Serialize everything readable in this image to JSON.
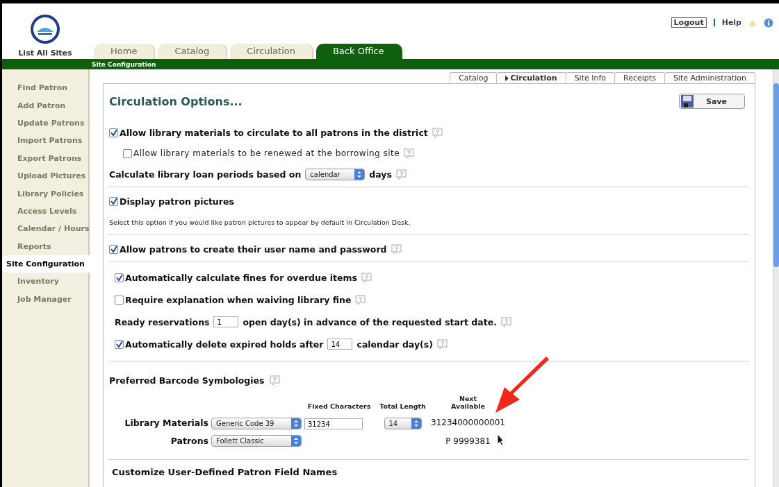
{
  "header": {
    "site_link": "List All Sites",
    "logout": "Logout",
    "help": "Help"
  },
  "main_tabs": [
    {
      "label": "Home",
      "selected": false
    },
    {
      "label": "Catalog",
      "selected": false
    },
    {
      "label": "Circulation",
      "selected": false
    },
    {
      "label": "Back Office",
      "selected": true
    }
  ],
  "subnav": "Site Configuration",
  "sidebar": {
    "items": [
      {
        "label": "Find Patron",
        "selected": false
      },
      {
        "label": "Add Patron",
        "selected": false
      },
      {
        "label": "Update Patrons",
        "selected": false
      },
      {
        "label": "Import Patrons",
        "selected": false
      },
      {
        "label": "Export Patrons",
        "selected": false
      },
      {
        "label": "Upload Pictures",
        "selected": false
      },
      {
        "label": "Library Policies",
        "selected": false
      },
      {
        "label": "Access Levels",
        "selected": false
      },
      {
        "label": "Calendar / Hours",
        "selected": false
      },
      {
        "label": "Reports",
        "selected": false
      },
      {
        "label": "Site Configuration",
        "selected": true
      },
      {
        "label": "Inventory",
        "selected": false
      },
      {
        "label": "Job Manager",
        "selected": false
      }
    ]
  },
  "sub_tabs": [
    {
      "label": "Catalog",
      "selected": false
    },
    {
      "label": "Circulation",
      "selected": true
    },
    {
      "label": "Site Info",
      "selected": false
    },
    {
      "label": "Receipts",
      "selected": false
    },
    {
      "label": "Site Administration",
      "selected": false
    }
  ],
  "panel": {
    "title": "Circulation Options...",
    "save_button": "Save",
    "sections": [
      {
        "inset": false,
        "rows": [
          {
            "kind": "check",
            "checked": true,
            "help": true,
            "parts": [
              {
                "kind": "text",
                "text": "Allow library materials to circulate to all patrons in the district"
              }
            ]
          },
          {
            "kind": "minor",
            "checked": false,
            "help": true,
            "parts": [
              {
                "kind": "text",
                "text": "Allow library materials to be renewed at the borrowing site"
              }
            ]
          },
          {
            "kind": "line",
            "help": true,
            "parts": [
              {
                "kind": "text",
                "text": "Calculate library loan periods based on"
              },
              {
                "kind": "select",
                "value": "calendar"
              },
              {
                "kind": "text",
                "text": "days"
              }
            ]
          }
        ]
      },
      {
        "inset": false,
        "rows": [
          {
            "kind": "check",
            "checked": true,
            "help": false,
            "parts": [
              {
                "kind": "text",
                "text": "Display patron pictures"
              }
            ]
          },
          {
            "kind": "note",
            "help": false,
            "parts": [
              {
                "kind": "text",
                "text": "Select this option if you would like patron pictures to appear by default in Circulation Desk."
              }
            ]
          }
        ]
      },
      {
        "inset": false,
        "rows": [
          {
            "kind": "check",
            "checked": true,
            "help": true,
            "parts": [
              {
                "kind": "text",
                "text": "Allow patrons to create their user name and password"
              }
            ]
          }
        ]
      },
      {
        "inset": true,
        "rows": [
          {
            "kind": "check",
            "checked": true,
            "help": true,
            "parts": [
              {
                "kind": "text",
                "text": "Automatically calculate fines for overdue items"
              }
            ]
          },
          {
            "kind": "check",
            "checked": false,
            "help": true,
            "parts": [
              {
                "kind": "text",
                "text": "Require explanation when waiving library fine"
              }
            ]
          },
          {
            "kind": "line",
            "help": true,
            "parts": [
              {
                "kind": "text",
                "text": "Ready reservations"
              },
              {
                "kind": "input",
                "value": "1"
              },
              {
                "kind": "text",
                "text": "open day(s) in advance of the requested start date."
              }
            ]
          },
          {
            "kind": "check",
            "checked": true,
            "help": true,
            "parts": [
              {
                "kind": "text",
                "text": "Automatically delete expired holds after"
              },
              {
                "kind": "input",
                "value": "14"
              },
              {
                "kind": "text",
                "text": "calendar day(s)"
              }
            ]
          }
        ]
      }
    ],
    "barcodes": {
      "title": "Preferred Barcode Symbologies",
      "columns": [
        "Fixed Characters",
        "Total Length",
        "Next Available"
      ],
      "rows": [
        {
          "label": "Library Materials",
          "symbology": "Generic Code 39",
          "fixed": "31234",
          "length": "14",
          "next": "31234000000001"
        },
        {
          "label": "Patrons",
          "symbology": "Follett Classic",
          "next": "P 9999381"
        }
      ]
    },
    "last_title": "Customize User-Defined Patron Field Names"
  }
}
